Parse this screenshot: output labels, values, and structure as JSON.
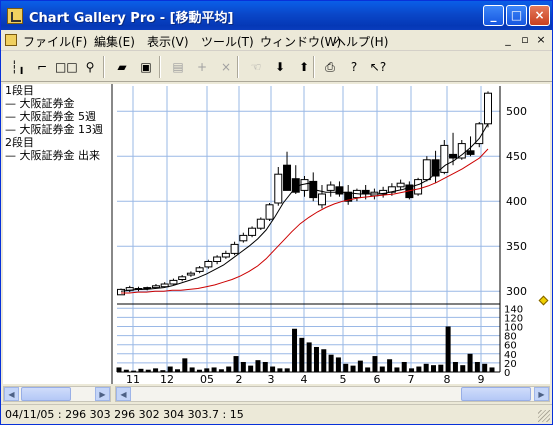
{
  "window": {
    "title": "Chart Gallery Pro - [移動平均]",
    "minimize": "_",
    "maximize": "□",
    "close": "×"
  },
  "menu": {
    "items": [
      "ファイル(F)",
      "編集(E)",
      "表示(V)",
      "ツール(T)",
      "ウィンドウ(W)",
      "ヘルプ(H)"
    ],
    "mdi_minimize": "_",
    "mdi_restore": "▫",
    "mdi_close": "×"
  },
  "toolbar": {
    "buttons": [
      {
        "icon": "candle-chart-icon",
        "glyph": "┆╻",
        "enabled": true
      },
      {
        "icon": "step-chart-icon",
        "glyph": "⌐",
        "enabled": true
      },
      {
        "icon": "two-panes-icon",
        "glyph": "□□",
        "enabled": true
      },
      {
        "icon": "binoculars-icon",
        "glyph": "⚲",
        "enabled": true
      },
      {
        "icon": "open-folder-icon",
        "glyph": "▰",
        "enabled": true
      },
      {
        "icon": "save-disk-icon",
        "glyph": "▣",
        "enabled": true
      },
      {
        "icon": "properties-icon",
        "glyph": "▤",
        "enabled": false
      },
      {
        "icon": "add-icon",
        "glyph": "+",
        "enabled": false
      },
      {
        "icon": "delete-icon",
        "glyph": "×",
        "enabled": false
      },
      {
        "icon": "cursor-hand-icon",
        "glyph": "☜",
        "enabled": false
      },
      {
        "icon": "move-down-icon",
        "glyph": "⬇",
        "enabled": true
      },
      {
        "icon": "move-up-icon",
        "glyph": "⬆",
        "enabled": true
      },
      {
        "icon": "print-icon",
        "glyph": "⎙",
        "enabled": true
      },
      {
        "icon": "help-icon",
        "glyph": "?",
        "enabled": true
      },
      {
        "icon": "context-help-icon",
        "glyph": "↖?",
        "enabled": true
      }
    ]
  },
  "legend": [
    "1段目",
    "— 大阪証券金",
    "— 大阪証券金 5週",
    "— 大阪証券金 13週",
    "2段目",
    "— 大阪証券金 出来"
  ],
  "chart_data": {
    "type": "candlestick",
    "price_axis": {
      "ticks": [
        300,
        350,
        400,
        450,
        500
      ],
      "range": [
        288,
        528
      ]
    },
    "volume_axis": {
      "ticks": [
        0,
        20,
        40,
        60,
        80,
        100,
        120,
        140
      ],
      "range": [
        0,
        145
      ]
    },
    "x_ticks": [
      "11",
      "12",
      "05",
      "2",
      "3",
      "4",
      "5",
      "6",
      "7",
      "8",
      "9"
    ],
    "colors": {
      "up": "#ffffff",
      "down": "#000000",
      "ma5": "#000000",
      "ma13": "#cc0000",
      "grid": "#9ab8e6"
    },
    "candles": [
      [
        296,
        303,
        296,
        302
      ],
      [
        301,
        306,
        299,
        304
      ],
      [
        303,
        305,
        300,
        302
      ],
      [
        303,
        305,
        301,
        304
      ],
      [
        304,
        308,
        303,
        306
      ],
      [
        305,
        310,
        304,
        308
      ],
      [
        308,
        314,
        307,
        312
      ],
      [
        313,
        318,
        311,
        316
      ],
      [
        318,
        322,
        316,
        320
      ],
      [
        322,
        328,
        320,
        326
      ],
      [
        327,
        335,
        325,
        333
      ],
      [
        333,
        340,
        330,
        338
      ],
      [
        338,
        345,
        336,
        342
      ],
      [
        342,
        355,
        340,
        352
      ],
      [
        356,
        365,
        354,
        362
      ],
      [
        362,
        372,
        360,
        370
      ],
      [
        370,
        382,
        368,
        380
      ],
      [
        380,
        398,
        378,
        396
      ],
      [
        398,
        438,
        395,
        430
      ],
      [
        440,
        455,
        432,
        412
      ],
      [
        425,
        440,
        408,
        410
      ],
      [
        412,
        428,
        405,
        424
      ],
      [
        422,
        432,
        400,
        404
      ],
      [
        396,
        418,
        392,
        408
      ],
      [
        412,
        422,
        405,
        418
      ],
      [
        416,
        422,
        405,
        408
      ],
      [
        410,
        418,
        396,
        400
      ],
      [
        404,
        414,
        400,
        412
      ],
      [
        412,
        418,
        402,
        408
      ],
      [
        406,
        414,
        402,
        410
      ],
      [
        408,
        416,
        404,
        412
      ],
      [
        410,
        420,
        406,
        416
      ],
      [
        416,
        424,
        412,
        420
      ],
      [
        418,
        422,
        402,
        404
      ],
      [
        408,
        426,
        406,
        424
      ],
      [
        424,
        450,
        422,
        446
      ],
      [
        446,
        456,
        420,
        428
      ],
      [
        432,
        468,
        430,
        462
      ],
      [
        452,
        476,
        440,
        448
      ],
      [
        448,
        468,
        446,
        464
      ],
      [
        456,
        472,
        450,
        452
      ],
      [
        464,
        488,
        460,
        486
      ],
      [
        486,
        522,
        482,
        520
      ]
    ],
    "ma5": [
      300,
      301,
      302,
      302,
      303,
      304,
      306,
      309,
      312,
      315,
      319,
      324,
      329,
      336,
      343,
      350,
      358,
      368,
      382,
      398,
      410,
      418,
      420,
      412,
      410,
      410,
      410,
      409,
      408,
      408,
      408,
      409,
      411,
      413,
      416,
      419,
      424,
      432,
      440,
      445,
      452,
      460,
      470,
      486
    ],
    "ma13": [
      298,
      298,
      299,
      299,
      300,
      300,
      301,
      301,
      302,
      303,
      305,
      307,
      310,
      313,
      317,
      322,
      328,
      336,
      346,
      356,
      366,
      375,
      382,
      388,
      393,
      397,
      400,
      402,
      404,
      405,
      406,
      407,
      408,
      410,
      412,
      414,
      417,
      421,
      426,
      431,
      436,
      442,
      448,
      458
    ],
    "volumes": [
      10,
      5,
      3,
      7,
      5,
      8,
      4,
      12,
      6,
      30,
      10,
      5,
      8,
      10,
      6,
      12,
      35,
      22,
      14,
      26,
      22,
      12,
      8,
      8,
      95,
      75,
      65,
      55,
      50,
      38,
      32,
      18,
      14,
      25,
      10,
      35,
      12,
      28,
      10,
      22,
      8,
      12,
      18,
      15,
      16,
      100,
      22,
      15,
      40,
      22,
      18,
      10
    ]
  },
  "status": {
    "text": "04/11/05 : 296 303 296 302 304 303.7 : 15"
  }
}
